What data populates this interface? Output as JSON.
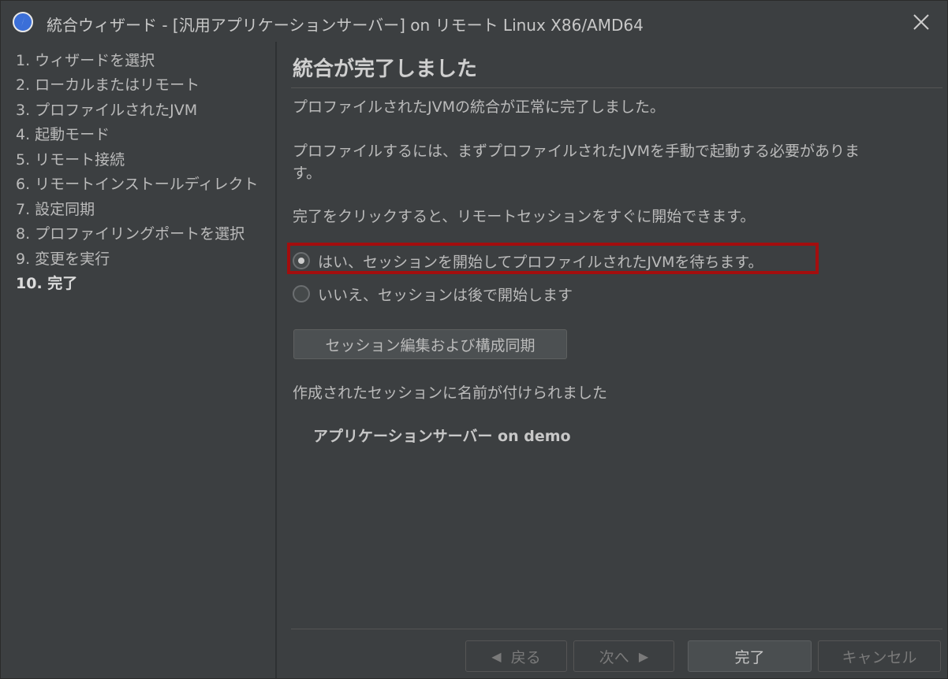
{
  "window": {
    "title": "統合ウィザード - [汎用アプリケーションサーバー] on リモート Linux X86/AMD64",
    "close_icon": "close-icon",
    "app_icon": "compass-icon"
  },
  "sidebar": {
    "steps": [
      {
        "label": "1. ウィザードを選択"
      },
      {
        "label": "2. ローカルまたはリモート"
      },
      {
        "label": "3. プロファイルされたJVM"
      },
      {
        "label": "4. 起動モード"
      },
      {
        "label": "5. リモート接続"
      },
      {
        "label": "6. リモートインストールディレクト"
      },
      {
        "label": "7. 設定同期"
      },
      {
        "label": "8. プロファイリングポートを選択"
      },
      {
        "label": "9. 変更を実行"
      },
      {
        "label": "10. 完了",
        "current": true
      }
    ]
  },
  "main": {
    "heading": "統合が完了しました",
    "message1": "プロファイルされたJVMの統合が正常に完了しました。",
    "message2": "プロファイルするには、まずプロファイルされたJVMを手動で起動する必要がありま",
    "message2_cont": "す。",
    "message3": "完了をクリックすると、リモートセッションをすぐに開始できます。",
    "radio_yes": {
      "label": "はい、セッションを開始してプロファイルされたJVMを待ちます。",
      "selected": true
    },
    "radio_no": {
      "label": "いいえ、セッションは後で開始します",
      "selected": false
    },
    "edit_session_button": "セッション編集および構成同期",
    "session_created_text": "作成されたセッションに名前が付けられました",
    "session_name": "アプリケーションサーバー on demo"
  },
  "footer": {
    "back_label": "戻る",
    "next_label": "次へ",
    "finish_label": "完了",
    "cancel_label": "キャンセル"
  },
  "colors": {
    "background": "#3c3f41",
    "text": "#bbbbbb",
    "highlight_border": "#a30e0e"
  }
}
